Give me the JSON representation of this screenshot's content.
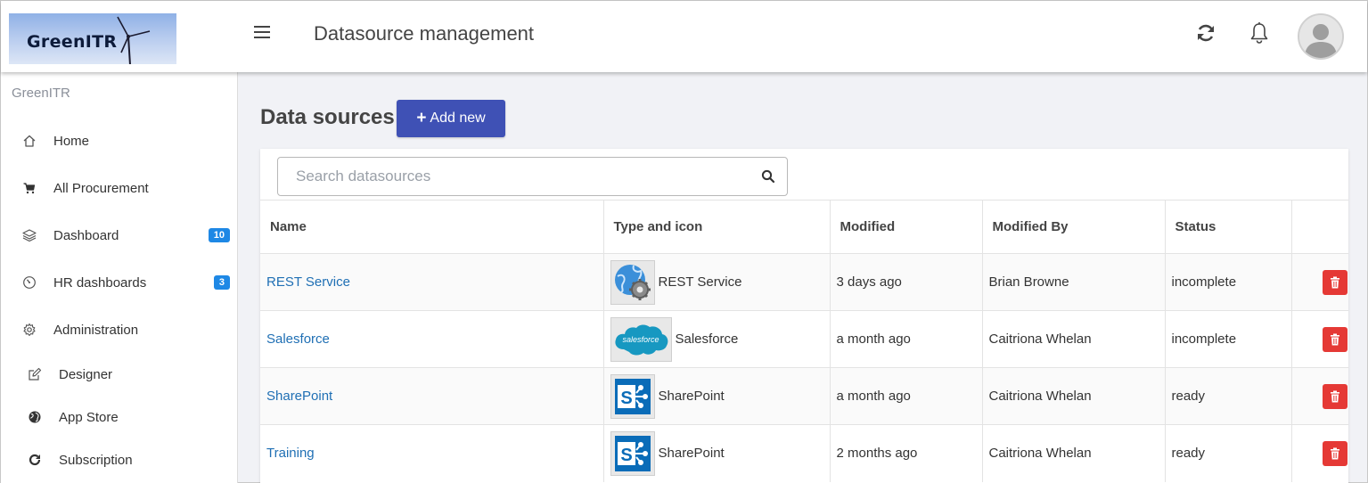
{
  "header": {
    "logo_text": "GreenITR",
    "title": "Datasource management"
  },
  "sidebar": {
    "title": "GreenITR",
    "items": [
      {
        "label": "Home",
        "icon": "home-icon"
      },
      {
        "label": "All Procurement",
        "icon": "cart-icon"
      },
      {
        "label": "Dashboard",
        "icon": "layers-icon",
        "badge": "10"
      },
      {
        "label": "HR dashboards",
        "icon": "gauge-icon",
        "badge": "3"
      },
      {
        "label": "Administration",
        "icon": "gear-icon"
      },
      {
        "label": "Designer",
        "icon": "edit-icon"
      },
      {
        "label": "App Store",
        "icon": "globe-icon"
      },
      {
        "label": "Subscription",
        "icon": "refresh-icon"
      }
    ]
  },
  "main": {
    "heading": "Data sources",
    "add_label": "Add new",
    "search_placeholder": "Search datasources",
    "columns": [
      "Name",
      "Type and icon",
      "Modified",
      "Modified By",
      "Status",
      ""
    ],
    "rows": [
      {
        "name": "REST Service",
        "type": "REST Service",
        "type_icon": "rest-service-icon",
        "modified": "3 days ago",
        "modified_by": "Brian Browne",
        "status": "incomplete"
      },
      {
        "name": "Salesforce",
        "type": "Salesforce",
        "type_icon": "salesforce-icon",
        "modified": "a month ago",
        "modified_by": "Caitriona Whelan",
        "status": "incomplete"
      },
      {
        "name": "SharePoint",
        "type": "SharePoint",
        "type_icon": "sharepoint-icon",
        "modified": "a month ago",
        "modified_by": "Caitriona Whelan",
        "status": "ready"
      },
      {
        "name": "Training",
        "type": "SharePoint",
        "type_icon": "sharepoint-icon",
        "modified": "2 months ago",
        "modified_by": "Caitriona Whelan",
        "status": "ready"
      }
    ]
  },
  "colors": {
    "primary": "#3f51b5",
    "link": "#1f6fb4",
    "delete": "#e53935",
    "badge": "#1e88e5",
    "sharepoint": "#0a6cb8",
    "salesforce": "#1798c1"
  }
}
